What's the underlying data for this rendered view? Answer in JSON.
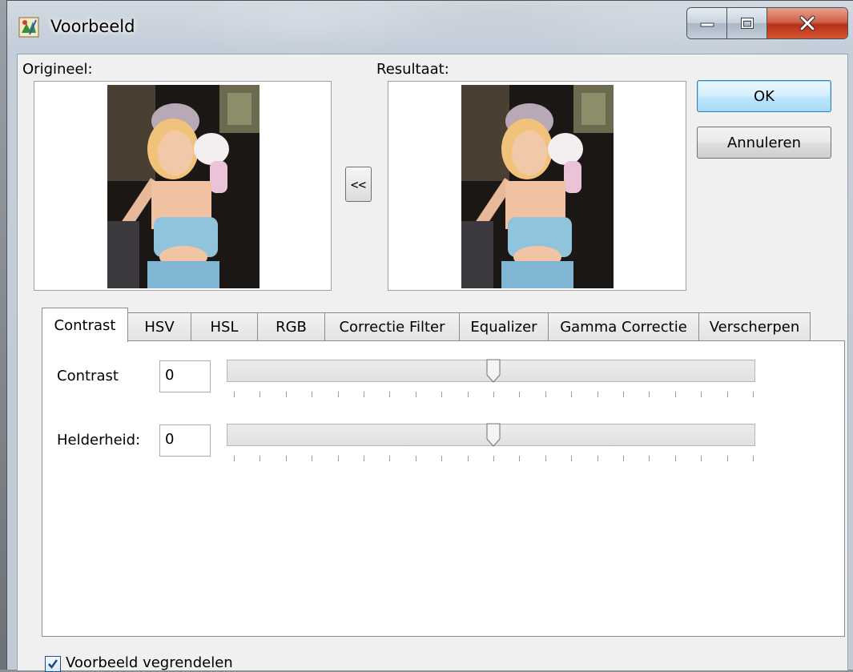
{
  "window": {
    "title": "Voorbeeld"
  },
  "preview": {
    "original_label": "Origineel:",
    "result_label": "Resultaat:",
    "swap_button": "<<"
  },
  "buttons": {
    "ok": "OK",
    "cancel": "Annuleren"
  },
  "tabs": [
    {
      "label": "Contrast",
      "active": true
    },
    {
      "label": "HSV",
      "active": false
    },
    {
      "label": "HSL",
      "active": false
    },
    {
      "label": "RGB",
      "active": false
    },
    {
      "label": "Correctie Filter",
      "active": false
    },
    {
      "label": "Equalizer",
      "active": false
    },
    {
      "label": "Gamma Correctie",
      "active": false
    },
    {
      "label": "Verscherpen",
      "active": false
    }
  ],
  "contrast_tab": {
    "contrast_label": "Contrast",
    "contrast_value": "0",
    "contrast_slider_level": 0.5,
    "brightness_label": "Helderheid:",
    "brightness_value": "0",
    "brightness_slider_level": 0.5
  },
  "footer": {
    "lock_preview_label": "Voorbeeld vegrendelen",
    "lock_preview_checked": true
  },
  "icons": {
    "app": "paint-icon",
    "minimize": "minimize-icon",
    "maximize": "maximize-icon",
    "close": "close-icon",
    "checkmark": "checkmark-icon"
  },
  "colors": {
    "default_button": "#bee6fd",
    "close_button": "#c7432a"
  }
}
